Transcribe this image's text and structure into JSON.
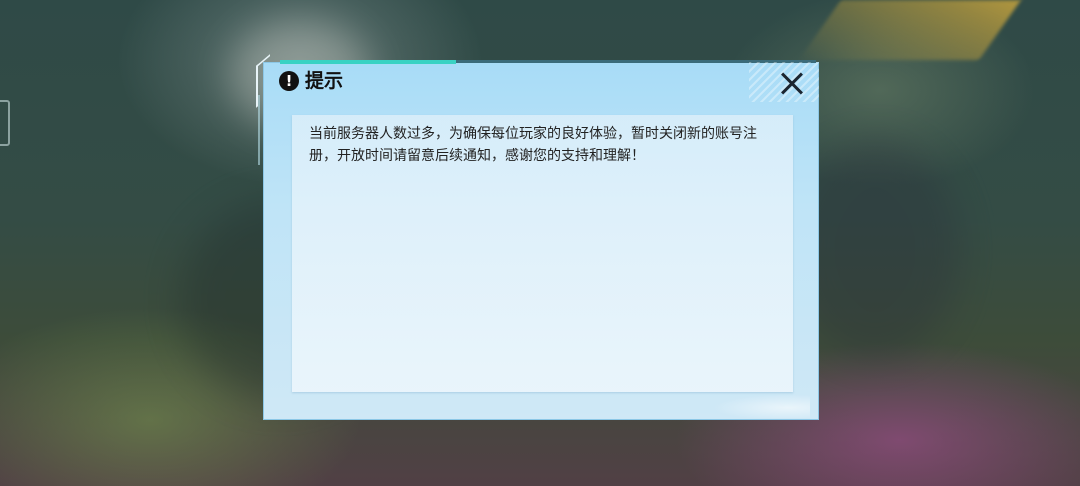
{
  "dialog": {
    "title": "提示",
    "warn_icon": "!",
    "message": "当前服务器人数过多，为确保每位玩家的良好体验，暂时关闭新的账号注册，开放时间请留意后续通知，感谢您的支持和理解！",
    "close_icon": "close-icon"
  },
  "colors": {
    "accent": "#3ad2c3",
    "dialog_bg": "#bfe4f7",
    "panel_bg": "#e8f4fb"
  }
}
